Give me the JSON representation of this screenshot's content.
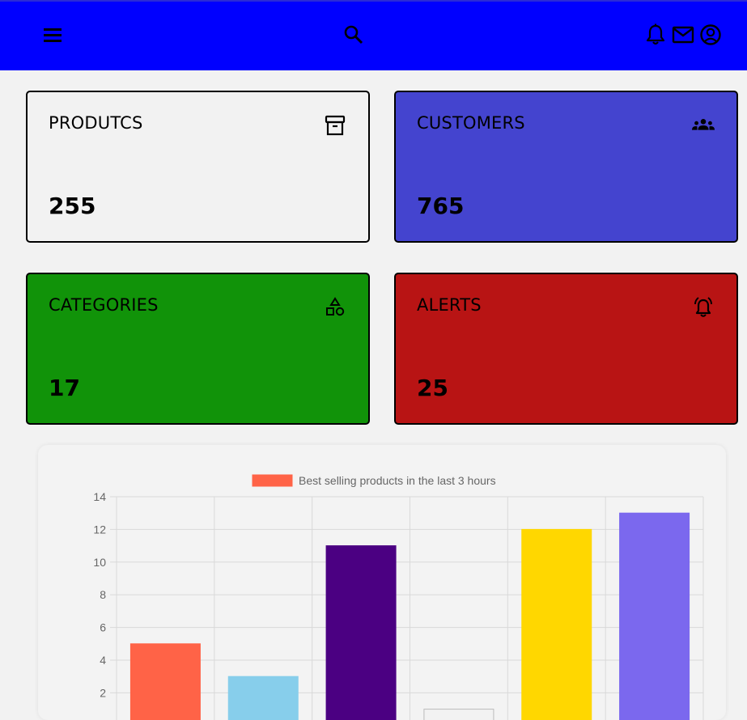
{
  "header": {
    "icons": [
      "menu-icon",
      "search-icon",
      "bell-icon",
      "mail-icon",
      "account-icon"
    ],
    "background": "#0000ff"
  },
  "cards": [
    {
      "title": "PRODUTCS",
      "value": "255",
      "icon": "archive-icon",
      "color": "#f2f2f2"
    },
    {
      "title": "CUSTOMERS",
      "value": "765",
      "icon": "people-icon",
      "color": "#4444cf"
    },
    {
      "title": "CATEGORIES",
      "value": "17",
      "icon": "shapes-icon",
      "color": "#119309"
    },
    {
      "title": "ALERTS",
      "value": "25",
      "icon": "alarm-icon",
      "color": "#b81414"
    }
  ],
  "chart_data": {
    "type": "bar",
    "legend": "Best selling products in the last 3 hours",
    "series": [
      {
        "name": "Best selling products in the last 3 hours",
        "values": [
          5,
          3,
          11,
          1,
          12,
          13
        ],
        "colors": [
          "#ff6347",
          "#87ceeb",
          "#4b0082",
          "#f2f2f2",
          "#ffd700",
          "#7b68ee"
        ]
      }
    ],
    "yticks": [
      "14",
      "12",
      "10",
      "8",
      "6",
      "4",
      "2"
    ],
    "ylim": [
      0,
      14
    ],
    "grid": true,
    "legend_position": "top-center"
  }
}
